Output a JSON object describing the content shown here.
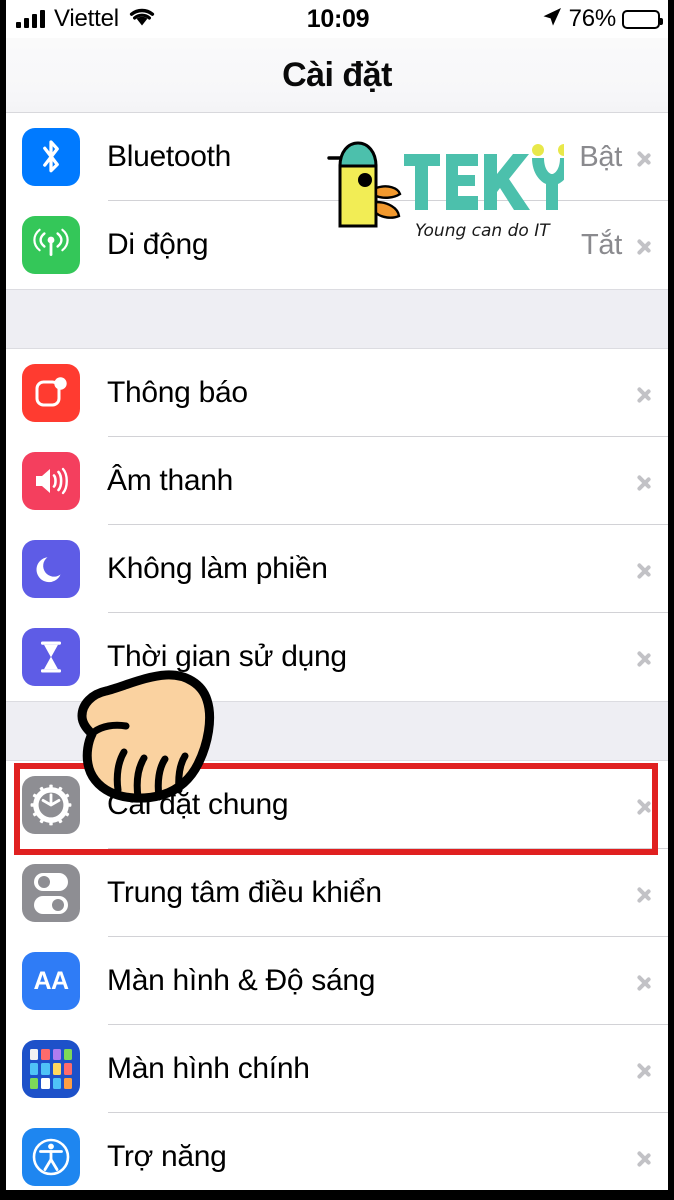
{
  "status_bar": {
    "carrier": "Viettel",
    "time": "10:09",
    "battery_percent": "76%",
    "signal_icon": "cellular-bars-icon",
    "wifi_icon": "wifi-icon",
    "location_icon": "location-arrow-icon",
    "battery_icon": "battery-icon",
    "battery_level": 76
  },
  "header": {
    "title": "Cài đặt"
  },
  "groups": [
    {
      "id": "connectivity",
      "rows": [
        {
          "label": "Bluetooth",
          "value": "Bật",
          "icon": "bluetooth-icon",
          "icon_color": "#007AFF",
          "chevron": "chevron-right-icon"
        },
        {
          "label": "Di động",
          "value": "Tắt",
          "icon": "cellular-icon",
          "icon_color": "#34C759",
          "chevron": "chevron-right-icon"
        }
      ]
    },
    {
      "id": "alerts",
      "rows": [
        {
          "label": "Thông báo",
          "value": "",
          "icon": "notifications-icon",
          "icon_color": "#FF3B30",
          "chevron": "chevron-right-icon"
        },
        {
          "label": "Âm thanh",
          "value": "",
          "icon": "sounds-icon",
          "icon_color": "#F43F5E",
          "chevron": "chevron-right-icon"
        },
        {
          "label": "Không làm phiền",
          "value": "",
          "icon": "do-not-disturb-moon-icon",
          "icon_color": "#5E5CE6",
          "chevron": "chevron-right-icon"
        },
        {
          "label": "Thời gian sử dụng",
          "value": "",
          "icon": "screen-time-hourglass-icon",
          "icon_color": "#5E5CE6",
          "chevron": "chevron-right-icon"
        }
      ]
    },
    {
      "id": "system",
      "rows": [
        {
          "label": "Cài đặt chung",
          "value": "",
          "icon": "gear-icon",
          "icon_color": "#8E8E93",
          "chevron": "chevron-right-icon",
          "highlighted": true
        },
        {
          "label": "Trung tâm điều khiển",
          "value": "",
          "icon": "control-center-icon",
          "icon_color": "#8E8E93",
          "chevron": "chevron-right-icon"
        },
        {
          "label": "Màn hình & Độ sáng",
          "value": "",
          "icon": "display-brightness-aa-icon",
          "icon_color": "#2F7CF6",
          "chevron": "chevron-right-icon",
          "icon_text": "AA"
        },
        {
          "label": "Màn hình chính",
          "value": "",
          "icon": "home-screen-grid-icon",
          "icon_color": "#1D51C9",
          "chevron": "chevron-right-icon"
        },
        {
          "label": "Trợ năng",
          "value": "",
          "icon": "accessibility-icon",
          "icon_color": "#1E86F0",
          "chevron": "chevron-right-icon"
        }
      ]
    }
  ],
  "annotations": {
    "highlight_box": {
      "name": "red-highlight-box",
      "target_label": "Cài đặt chung",
      "color": "#E02020"
    },
    "pointer_hand": {
      "name": "pointing-hand-cursor",
      "target_label": "Cài đặt chung",
      "skin_color": "#FAD2A0"
    }
  },
  "watermark": {
    "brand": "TEKY",
    "tagline": "Young can do IT",
    "brand_color": "#4CC0AC",
    "bird_body_color": "#F2ED55",
    "bird_cap_color": "#4CC0AC",
    "bird_beak_color": "#F2992E"
  }
}
